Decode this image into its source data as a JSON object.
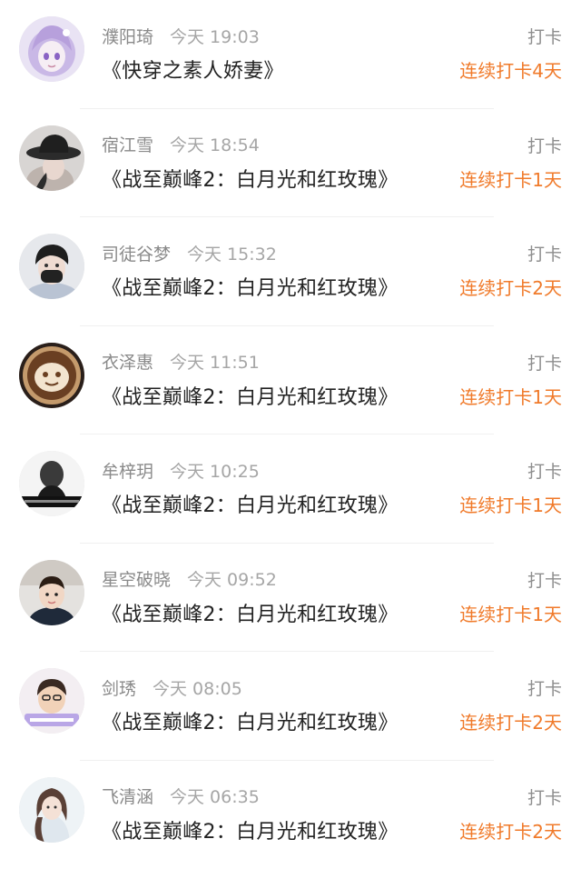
{
  "accent_color": "#f07a2a",
  "entries": [
    {
      "name": "濮阳琦",
      "time": "今天 19:03",
      "book": "《快穿之素人娇妻》",
      "action": "打卡",
      "streak": "连续打卡4天",
      "avatar_icon": "anime-girl-avatar"
    },
    {
      "name": "宿江雪",
      "time": "今天 18:54",
      "book": "《战至巅峰2：白月光和红玫瑰》",
      "action": "打卡",
      "streak": "连续打卡1天",
      "avatar_icon": "hat-woman-avatar"
    },
    {
      "name": "司徒谷梦",
      "time": "今天 15:32",
      "book": "《战至巅峰2：白月光和红玫瑰》",
      "action": "打卡",
      "streak": "连续打卡2天",
      "avatar_icon": "masked-man-avatar"
    },
    {
      "name": "衣泽惠",
      "time": "今天 11:51",
      "book": "《战至巅峰2：白月光和红玫瑰》",
      "action": "打卡",
      "streak": "连续打卡1天",
      "avatar_icon": "latte-art-avatar"
    },
    {
      "name": "牟梓玥",
      "time": "今天 10:25",
      "book": "《战至巅峰2：白月光和红玫瑰》",
      "action": "打卡",
      "streak": "连续打卡1天",
      "avatar_icon": "bw-portrait-avatar"
    },
    {
      "name": "星空破晓",
      "time": "今天 09:52",
      "book": "《战至巅峰2：白月光和红玫瑰》",
      "action": "打卡",
      "streak": "连续打卡1天",
      "avatar_icon": "child-avatar"
    },
    {
      "name": "剑琇",
      "time": "今天 08:05",
      "book": "《战至巅峰2：白月光和红玫瑰》",
      "action": "打卡",
      "streak": "连续打卡2天",
      "avatar_icon": "cartoon-boy-avatar"
    },
    {
      "name": "飞清涵",
      "time": "今天 06:35",
      "book": "《战至巅峰2：白月光和红玫瑰》",
      "action": "打卡",
      "streak": "连续打卡2天",
      "avatar_icon": "illustrated-girl-avatar"
    }
  ]
}
